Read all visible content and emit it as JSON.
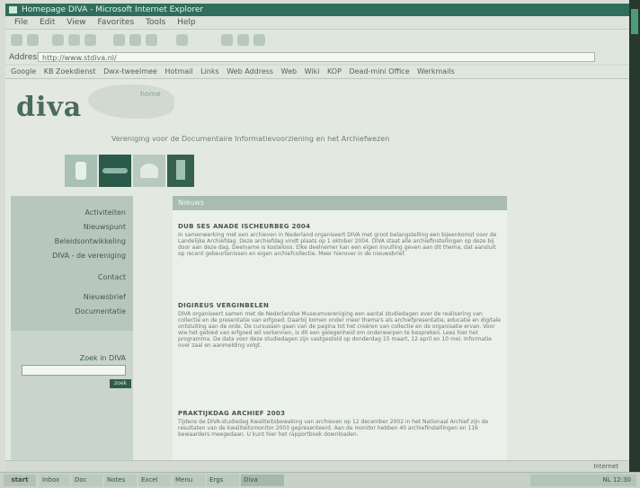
{
  "window": {
    "title": "Homepage DIVA - Microsoft Internet Explorer"
  },
  "menu": [
    "File",
    "Edit",
    "View",
    "Favorites",
    "Tools",
    "Help"
  ],
  "toolbar": {
    "back": "Back",
    "search": "Search",
    "favorites": "Favorites",
    "media": "Media"
  },
  "address": {
    "label": "Address",
    "value": "http://www.stdiva.nl/"
  },
  "links": [
    "Google",
    "KB Zoekdienst",
    "Dwx-tweelmee",
    "Hotmail",
    "Links",
    "Web Address",
    "Web",
    "Wiki",
    "KOP",
    "Dead-mini Office",
    "Werkmails"
  ],
  "page": {
    "logo": "diva",
    "home_link": "home",
    "tagline": "Vereniging voor de Documentaire Informatievoorziening en het Archiefwezen",
    "nav": [
      "Activiteiten",
      "Nieuwspunt",
      "Beleidsontwikkeling",
      "DIVA - de vereniging",
      "Contact",
      "Nieuwsbrief",
      "Documentatie"
    ],
    "search": {
      "title": "Zoek in DIVA",
      "button": "zoek"
    },
    "content_header": "Nieuws",
    "articles": [
      {
        "title": "DUB SES ANADE ISCHEURBEG 2004",
        "body": "In samenwerking met een archieven in Nederland organiseert DIVA met groot belangstelling een bijeenkomst voor de Landelijke Archiefdag. Deze archiefdag vindt plaats op 1 oktober 2004. DIVA staat alle archiefinstellingen op deze bij door aan deze dag. Deelname is kosteloos. Elke deelnemer kan een eigen invulling geven aan dit thema, dat aansluit op recent gebeurtenissen en eigen archiefcollectie. Meer hierover in de nieuwsbrief."
      },
      {
        "title": "DIGIREUS VERGINBELEN",
        "body": "DIVA organiseert samen met de Nederlandse Museumvereniging een aantal studiedagen over de realisering van collectie en de presentatie van erfgoed. Daarbij komen onder meer thema's als archiefpresentatie, educatie en digitale ontsluiting aan de orde. De cursussen gaan van de pagina tot het creëren van collectie en de organisatie ervan. Voor wie het gebied van erfgoed wil verkennen, is dit een gelegenheid om onderwerpen te bespreken. Lees hier het programma. De data voor deze studiedagen zijn vastgesteld op donderdag 15 maart, 12 april en 10 mei. Informatie over zaal en aanmelding volgt."
      },
      {
        "title": "PRAKTIJKDAG ARCHIEF 2003",
        "body": "Tijdens de DIVA-studiedag Kwaliteitsbewaking van archieven op 12 december 2002 in het Nationaal Archief zijn de resultaten van de kwaliteitsmonitor 2003 gepresenteerd. Aan de monitor hebben 40 archiefinstellingen en 116 bewaarders meegedaan. U kunt hier het rapportboek downloaden."
      }
    ]
  },
  "status": {
    "left": "",
    "right": "Internet"
  },
  "taskbar": {
    "start": "start",
    "tasks": [
      "Inbox",
      "Doc",
      "Notes",
      "Excel",
      "Menu",
      "Ergs",
      "Diva"
    ],
    "tray": "NL 12:30"
  }
}
